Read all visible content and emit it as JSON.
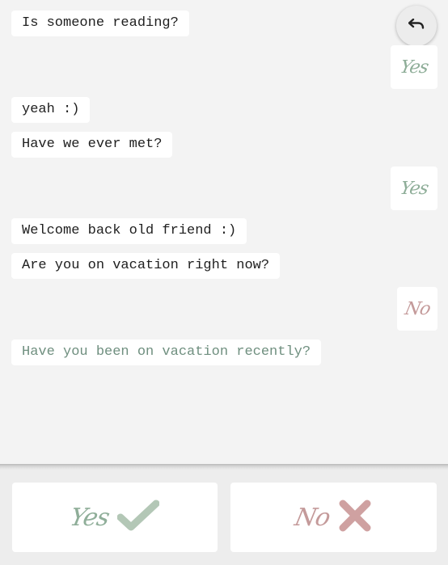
{
  "messages": [
    {
      "from": "bot",
      "text": "Is someone reading?"
    },
    {
      "from": "user",
      "answer": "Yes"
    },
    {
      "from": "bot",
      "text": "yeah :)"
    },
    {
      "from": "bot",
      "text": "Have we ever met?"
    },
    {
      "from": "user",
      "answer": "Yes"
    },
    {
      "from": "bot",
      "text": "Welcome back old friend :)"
    },
    {
      "from": "bot",
      "text": "Are you on vacation right now?"
    },
    {
      "from": "user",
      "answer": "No"
    },
    {
      "from": "bot",
      "text": "Have you been on vacation recently?",
      "pending": true
    }
  ],
  "controls": {
    "undo_icon": "undo-arrow-icon",
    "yes_label": "Yes",
    "no_label": "No",
    "yes_icon": "checkmark-icon",
    "no_icon": "cross-icon"
  },
  "colors": {
    "background": "#f3f3f3",
    "bubble": "#ffffff",
    "text": "#1f1f1f",
    "pending_text": "#6f8f7f",
    "yes_accent": "#8fae99",
    "no_accent": "#c49a9a"
  }
}
